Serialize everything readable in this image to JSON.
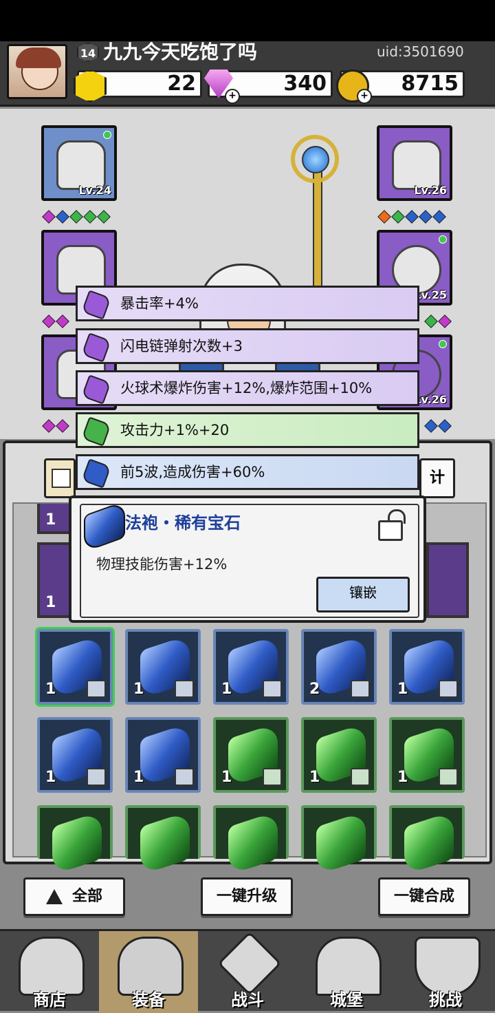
{
  "header": {
    "player_level": "14",
    "player_name": "九九今天吃饱了吗",
    "uid": "uid:3501690",
    "resources": [
      {
        "icon": "gold-hexagon-icon",
        "value": "22"
      },
      {
        "icon": "purple-diamond-icon",
        "value": "340"
      },
      {
        "icon": "gold-coin-icon",
        "value": "8715"
      }
    ]
  },
  "equipment": {
    "left": [
      {
        "icon": "helmet-icon",
        "level": "Lv.24",
        "color": "#6e8fc9"
      },
      {
        "icon": "cloak-icon",
        "level": "",
        "color": "#8a5cc6"
      },
      {
        "icon": "boots-icon",
        "level": "",
        "color": "#8a5cc6"
      }
    ],
    "right": [
      {
        "icon": "glove-icon",
        "level": "Lv.26",
        "color": "#8a5cc6"
      },
      {
        "icon": "ring-icon",
        "level": "Lv.25",
        "color": "#8a5cc6"
      },
      {
        "icon": "necklace-icon",
        "level": "Lv.26",
        "color": "#8a5cc6"
      }
    ]
  },
  "stats": [
    {
      "text": "暴击率+4%",
      "gem": "purple"
    },
    {
      "text": "闪电链弹射次数+3",
      "gem": "purple"
    },
    {
      "text": "火球术爆炸伤害+12%,爆炸范围+10%",
      "gem": "purple"
    },
    {
      "text": "攻击力+1%+20",
      "gem": "green"
    },
    {
      "text": "前5波,造成伤害+60%",
      "gem": "blue"
    }
  ],
  "tab_partial": "计",
  "gem_popup": {
    "title": "法袍・稀有宝石",
    "description": "物理技能伤害+12%",
    "button": "镶嵌"
  },
  "inventory": {
    "rows": [
      [
        {
          "c": "1",
          "t": "blue"
        },
        {
          "c": "1",
          "t": "blue"
        },
        {
          "c": "1",
          "t": "blue"
        },
        {
          "c": "2",
          "t": "blue"
        },
        {
          "c": "1",
          "t": "blue"
        }
      ],
      [
        {
          "c": "1",
          "t": "blue"
        },
        {
          "c": "1",
          "t": "blue"
        },
        {
          "c": "1",
          "t": "green"
        },
        {
          "c": "1",
          "t": "green"
        },
        {
          "c": "1",
          "t": "green"
        }
      ]
    ],
    "hidden_count": "1"
  },
  "actions": {
    "all": "全部",
    "upgrade_all": "一键升级",
    "merge_all": "一键合成"
  },
  "nav": [
    {
      "label": "商店",
      "icon": "shop-icon"
    },
    {
      "label": "装备",
      "icon": "backpack-icon"
    },
    {
      "label": "战斗",
      "icon": "crossed-swords-icon"
    },
    {
      "label": "城堡",
      "icon": "castle-icon"
    },
    {
      "label": "挑战",
      "icon": "shield-icon"
    }
  ]
}
